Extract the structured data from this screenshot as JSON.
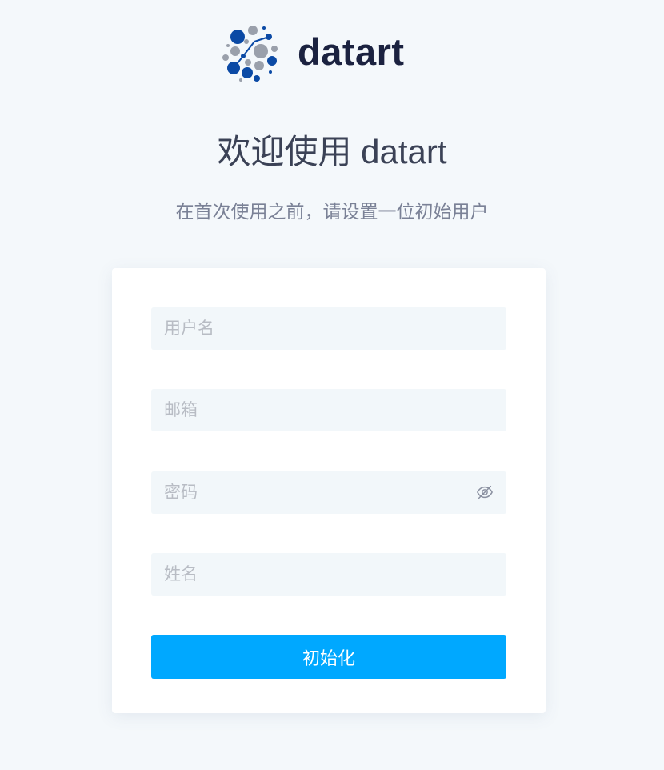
{
  "brand": {
    "name": "datart",
    "logo_icon": "network-dots-logo",
    "logo_colors": [
      "#0b4aa5",
      "#9aa0ab"
    ]
  },
  "welcome": {
    "title": "欢迎使用 datart",
    "subtitle": "在首次使用之前，请设置一位初始用户"
  },
  "form": {
    "username": {
      "placeholder": "用户名",
      "value": ""
    },
    "email": {
      "placeholder": "邮箱",
      "value": ""
    },
    "password": {
      "placeholder": "密码",
      "value": "",
      "toggle_icon": "eye-invisible-icon"
    },
    "name": {
      "placeholder": "姓名",
      "value": ""
    },
    "submit_label": "初始化"
  },
  "colors": {
    "page_background": "#f4f8fb",
    "card_background": "#ffffff",
    "input_background": "#f2f7fa",
    "primary": "#00a8ff",
    "brand_text": "#1b2240"
  }
}
